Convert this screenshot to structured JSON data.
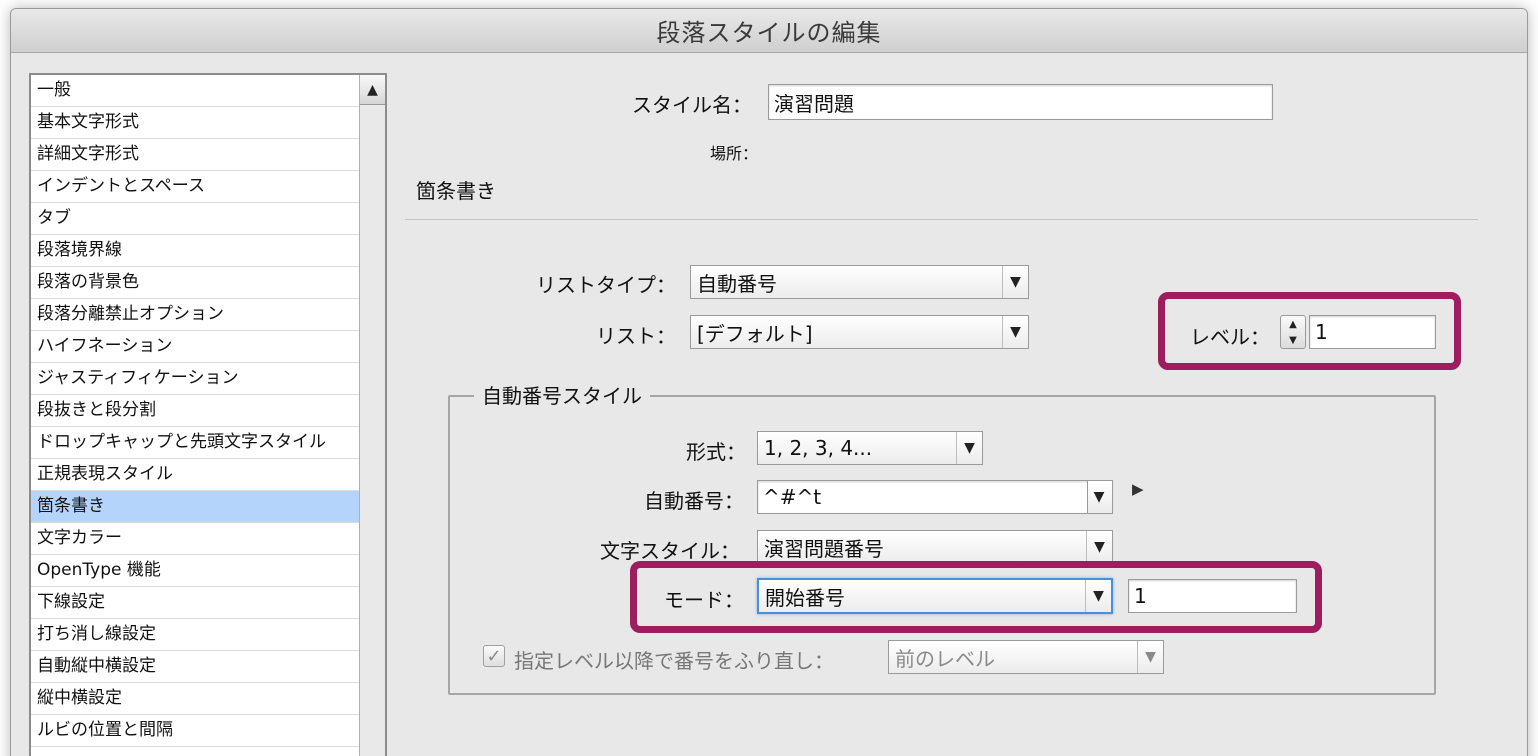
{
  "window": {
    "title": "段落スタイルの編集"
  },
  "sidebar": {
    "items": [
      "一般",
      "基本文字形式",
      "詳細文字形式",
      "インデントとスペース",
      "タブ",
      "段落境界線",
      "段落の背景色",
      "段落分離禁止オプション",
      "ハイフネーション",
      "ジャスティフィケーション",
      "段抜きと段分割",
      "ドロップキャップと先頭文字スタイル",
      "正規表現スタイル",
      "箇条書き",
      "文字カラー",
      "OpenType 機能",
      "下線設定",
      "打ち消し線設定",
      "自動縦中横設定",
      "縦中横設定",
      "ルビの位置と間隔"
    ],
    "selected": "箇条書き"
  },
  "header": {
    "style_name_label": "スタイル名：",
    "style_name_value": "演習問題",
    "location_label": "場所：",
    "section_title": "箇条書き"
  },
  "list": {
    "type_label": "リストタイプ：",
    "type_value": "自動番号",
    "list_label": "リスト：",
    "list_value": "[デフォルト]",
    "level_label": "レベル：",
    "level_value": "1"
  },
  "numbering": {
    "group_title": "自動番号スタイル",
    "format_label": "形式：",
    "format_value": "1, 2, 3, 4...",
    "number_label": "自動番号：",
    "number_value": "^#^t",
    "char_style_label": "文字スタイル：",
    "char_style_value": "演習問題番号",
    "mode_label": "モード：",
    "mode_value": "開始番号",
    "mode_start": "1",
    "restart_label": "指定レベル以降で番号をふり直し：",
    "restart_checked": true,
    "restart_value": "前のレベル"
  },
  "colors": {
    "highlight": "#9e1d5e",
    "selection": "#b5d4fb",
    "focus": "#4a90d9"
  }
}
